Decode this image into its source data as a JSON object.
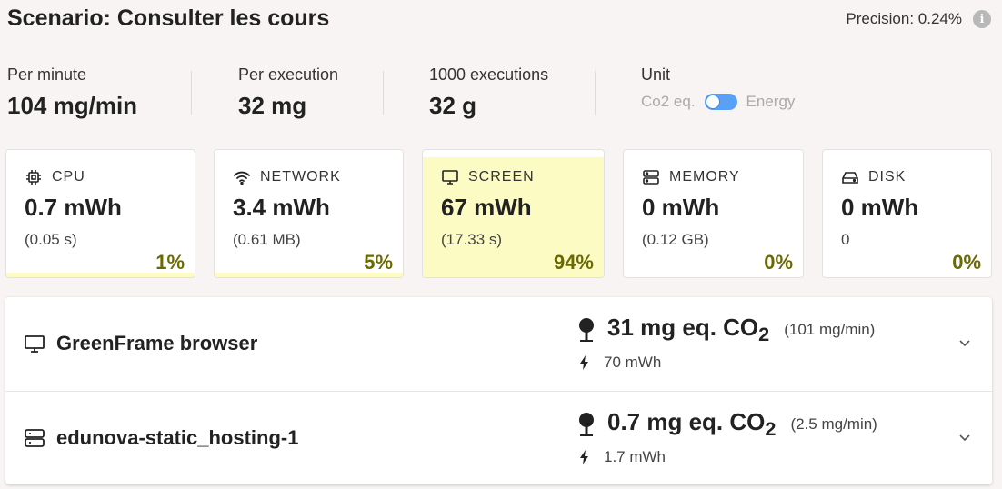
{
  "header": {
    "title": "Scenario: Consulter les cours",
    "precision": "Precision: 0.24%",
    "info_glyph": "i"
  },
  "stats": [
    {
      "label": "Per minute",
      "value": "104 mg/min"
    },
    {
      "label": "Per execution",
      "value": "32 mg"
    },
    {
      "label": "1000 executions",
      "value": "32 g"
    }
  ],
  "unit": {
    "label": "Unit",
    "left_option": "Co2 eq.",
    "right_option": "Energy",
    "selected": "Energy",
    "toggle_color": "#5aa0f5"
  },
  "cards": [
    {
      "icon": "cpu-icon",
      "label": "CPU",
      "value": "0.7 mWh",
      "detail": "(0.05 s)",
      "percent": "1%",
      "share": 0.01
    },
    {
      "icon": "wifi-icon",
      "label": "NETWORK",
      "value": "3.4 mWh",
      "detail": "(0.61 MB)",
      "percent": "5%",
      "share": 0.05
    },
    {
      "icon": "monitor-icon",
      "label": "SCREEN",
      "value": "67 mWh",
      "detail": "(17.33 s)",
      "percent": "94%",
      "share": 0.94
    },
    {
      "icon": "memory-icon",
      "label": "MEMORY",
      "value": "0 mWh",
      "detail": "(0.12 GB)",
      "percent": "0%",
      "share": 0
    },
    {
      "icon": "disk-icon",
      "label": "DISK",
      "value": "0 mWh",
      "detail": "0",
      "percent": "0%",
      "share": 0
    }
  ],
  "colors": {
    "bar_fill": "#fdfbc4",
    "percent_text": "#6a6a00"
  },
  "containers": [
    {
      "icon": "monitor-icon",
      "name": "GreenFrame browser",
      "co2_amount": "31 mg eq. CO",
      "co2_subscript": "2",
      "co2_rate": "(101 mg/min)",
      "energy": "70 mWh"
    },
    {
      "icon": "server-icon",
      "name": "edunova-static_hosting-1",
      "co2_amount": "0.7 mg eq. CO",
      "co2_subscript": "2",
      "co2_rate": "(2.5 mg/min)",
      "energy": "1.7 mWh"
    }
  ]
}
